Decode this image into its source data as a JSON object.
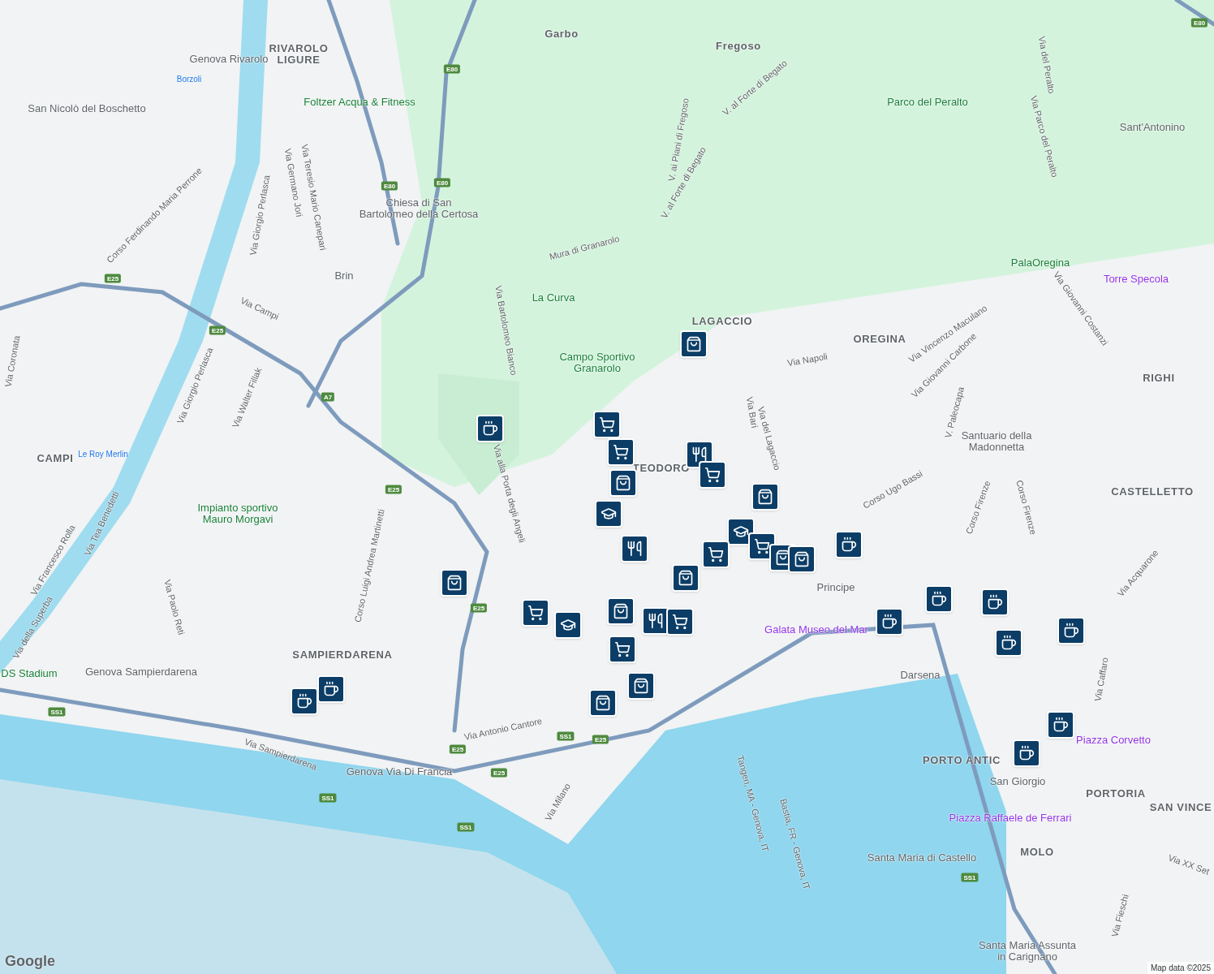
{
  "labels": [
    {
      "kind": "area",
      "text": "RIVAROLO\nLIGURE"
    },
    {
      "kind": "area",
      "text": "Garbo"
    },
    {
      "kind": "area",
      "text": "Fregoso"
    },
    {
      "kind": "area",
      "text": "LAGACCIO"
    },
    {
      "kind": "area",
      "text": "OREGINA"
    },
    {
      "kind": "area",
      "text": "RIGHI"
    },
    {
      "kind": "area",
      "text": "CASTELLETTO"
    },
    {
      "kind": "area",
      "text": "CAMPI"
    },
    {
      "kind": "area",
      "text": "SAMPIERDARENA"
    },
    {
      "kind": "area",
      "text": "PORTORIA"
    },
    {
      "kind": "area",
      "text": "SAN VINCE"
    },
    {
      "kind": "area",
      "text": "MOLO"
    },
    {
      "kind": "area",
      "text": "PORTO ANTIC"
    },
    {
      "kind": "area",
      "text": "TEODORO"
    },
    {
      "kind": "park",
      "text": "Foltzer Acqua & Fitness"
    },
    {
      "kind": "park",
      "text": "Parco del Peralto"
    },
    {
      "kind": "park",
      "text": "La Curva"
    },
    {
      "kind": "park",
      "text": "Campo Sportivo\nGranarolo"
    },
    {
      "kind": "park",
      "text": "PalaOregina"
    },
    {
      "kind": "park",
      "text": "Impianto sportivo\nMauro Morgavi"
    },
    {
      "kind": "park",
      "text": "DS Stadium"
    },
    {
      "kind": "sight",
      "text": "Torre Specola"
    },
    {
      "kind": "sight",
      "text": "Galata Museo del Mar"
    },
    {
      "kind": "sight",
      "text": "Piazza Corvetto"
    },
    {
      "kind": "sight",
      "text": "Piazza Raffaele de Ferrari"
    },
    {
      "kind": "place",
      "text": "San Nicolò del Boschetto"
    },
    {
      "kind": "place",
      "text": "Genova Rivarolo"
    },
    {
      "kind": "place",
      "text": "Chiesa di San\nBartolomeo della Certosa"
    },
    {
      "kind": "place",
      "text": "Brin"
    },
    {
      "kind": "place",
      "text": "Genova Sampierdarena"
    },
    {
      "kind": "place",
      "text": "Genova Via Di Francia"
    },
    {
      "kind": "place",
      "text": "Sant'Antonino"
    },
    {
      "kind": "place",
      "text": "Santuario della\nMadonnetta"
    },
    {
      "kind": "place",
      "text": "Principe"
    },
    {
      "kind": "place",
      "text": "Darsena"
    },
    {
      "kind": "place",
      "text": "San Giorgio"
    },
    {
      "kind": "place",
      "text": "Santa Maria di Castello"
    },
    {
      "kind": "place",
      "text": "Santa Maria Assunta\nin Carignano"
    },
    {
      "kind": "small",
      "text": "Borzoli"
    },
    {
      "kind": "small",
      "text": "Le Roy Merlin"
    },
    {
      "kind": "street",
      "text": "Via Giorgio Perlasca"
    },
    {
      "kind": "street",
      "text": "Via Germano Jori"
    },
    {
      "kind": "street",
      "text": "Via Teresio Mario Canepari"
    },
    {
      "kind": "street",
      "text": "Corso Ferdinando Maria Perrone"
    },
    {
      "kind": "street",
      "text": "Via Campi"
    },
    {
      "kind": "street",
      "text": "Via Walter Fillak"
    },
    {
      "kind": "street",
      "text": "Via Giorgio Perlasca"
    },
    {
      "kind": "street",
      "text": "Via Tea Benedetti"
    },
    {
      "kind": "street",
      "text": "Via Francesco Rolla"
    },
    {
      "kind": "street",
      "text": "Via della Superba"
    },
    {
      "kind": "street",
      "text": "Via Paolo Reti"
    },
    {
      "kind": "street",
      "text": "Corso Luigi Andrea Martinetti"
    },
    {
      "kind": "street",
      "text": "Via Antonio Cantore"
    },
    {
      "kind": "street",
      "text": "Via Sampierdarena"
    },
    {
      "kind": "street",
      "text": "Via Milano"
    },
    {
      "kind": "street",
      "text": "Via alla Porta degli Angeli"
    },
    {
      "kind": "street",
      "text": "Via Bartolomeo Bianco"
    },
    {
      "kind": "street",
      "text": "Mura di Granarolo"
    },
    {
      "kind": "street",
      "text": "V. al Forte di Begato"
    },
    {
      "kind": "street",
      "text": "V. ai Piani di Fregoso"
    },
    {
      "kind": "street",
      "text": "V. al Forte di Begato"
    },
    {
      "kind": "street",
      "text": "Via Bari"
    },
    {
      "kind": "street",
      "text": "Via del Lagaccio"
    },
    {
      "kind": "street",
      "text": "Via Napoli"
    },
    {
      "kind": "street",
      "text": "Via Vincenzo Maculano"
    },
    {
      "kind": "street",
      "text": "Via Giovanni Carbone"
    },
    {
      "kind": "street",
      "text": "V. Paleocapa"
    },
    {
      "kind": "street",
      "text": "Corso Ugo Bassi"
    },
    {
      "kind": "street",
      "text": "Corso Firenze"
    },
    {
      "kind": "street",
      "text": "Corso Firenze"
    },
    {
      "kind": "street",
      "text": "Via Acquarone"
    },
    {
      "kind": "street",
      "text": "Via Giovanni Costanzi"
    },
    {
      "kind": "street",
      "text": "Via del Peralto"
    },
    {
      "kind": "street",
      "text": "Via Parco del Peralto"
    },
    {
      "kind": "street",
      "text": "Via Caffaro"
    },
    {
      "kind": "street",
      "text": "Via Coronata"
    },
    {
      "kind": "street",
      "text": "Tangeri, MA - Genova, IT"
    },
    {
      "kind": "street",
      "text": "Bastia, FR - Genova, IT"
    },
    {
      "kind": "street",
      "text": "Via Fieschi"
    },
    {
      "kind": "street",
      "text": "Via XX Set"
    }
  ],
  "shields": [
    {
      "text": "E80"
    },
    {
      "text": "E80"
    },
    {
      "text": "E80"
    },
    {
      "text": "E25"
    },
    {
      "text": "E25"
    },
    {
      "text": "A7"
    },
    {
      "text": "E25"
    },
    {
      "text": "E25"
    },
    {
      "text": "SS1"
    },
    {
      "text": "SS1"
    },
    {
      "text": "SS1"
    },
    {
      "text": "SS1"
    },
    {
      "text": "E25"
    },
    {
      "text": "E25"
    },
    {
      "text": "E25"
    },
    {
      "text": "SS1"
    },
    {
      "text": "E80"
    }
  ],
  "markers": [
    {
      "kind": "bag"
    },
    {
      "kind": "cart"
    },
    {
      "kind": "cafe"
    },
    {
      "kind": "cart"
    },
    {
      "kind": "bag"
    },
    {
      "kind": "food"
    },
    {
      "kind": "cart"
    },
    {
      "kind": "bag"
    },
    {
      "kind": "bag"
    },
    {
      "kind": "school"
    },
    {
      "kind": "school"
    },
    {
      "kind": "food"
    },
    {
      "kind": "cart"
    },
    {
      "kind": "cart"
    },
    {
      "kind": "bag"
    },
    {
      "kind": "bag"
    },
    {
      "kind": "cafe"
    },
    {
      "kind": "bag"
    },
    {
      "kind": "cart"
    },
    {
      "kind": "school"
    },
    {
      "kind": "bag"
    },
    {
      "kind": "food"
    },
    {
      "kind": "cart"
    },
    {
      "kind": "cart"
    },
    {
      "kind": "bag"
    },
    {
      "kind": "bag"
    },
    {
      "kind": "cafe"
    },
    {
      "kind": "cafe"
    },
    {
      "kind": "cafe"
    },
    {
      "kind": "cafe"
    },
    {
      "kind": "cafe"
    },
    {
      "kind": "cafe"
    },
    {
      "kind": "cafe"
    },
    {
      "kind": "cafe"
    },
    {
      "kind": "cafe"
    }
  ],
  "footer": {
    "logo": "Google",
    "attribution": "Map data ©2025"
  }
}
